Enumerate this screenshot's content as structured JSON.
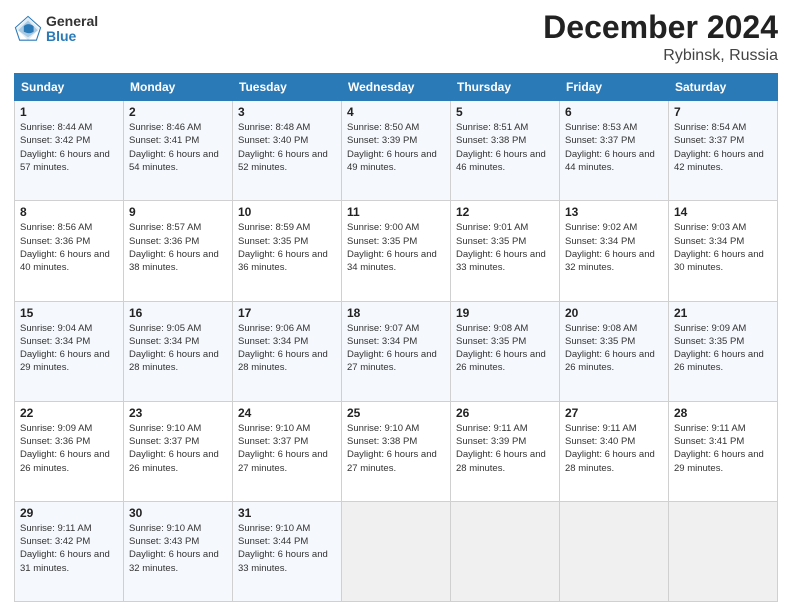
{
  "header": {
    "logo_general": "General",
    "logo_blue": "Blue",
    "title": "December 2024",
    "location": "Rybinsk, Russia"
  },
  "columns": [
    "Sunday",
    "Monday",
    "Tuesday",
    "Wednesday",
    "Thursday",
    "Friday",
    "Saturday"
  ],
  "weeks": [
    [
      {
        "day": "1",
        "sunrise": "Sunrise: 8:44 AM",
        "sunset": "Sunset: 3:42 PM",
        "daylight": "Daylight: 6 hours and 57 minutes."
      },
      {
        "day": "2",
        "sunrise": "Sunrise: 8:46 AM",
        "sunset": "Sunset: 3:41 PM",
        "daylight": "Daylight: 6 hours and 54 minutes."
      },
      {
        "day": "3",
        "sunrise": "Sunrise: 8:48 AM",
        "sunset": "Sunset: 3:40 PM",
        "daylight": "Daylight: 6 hours and 52 minutes."
      },
      {
        "day": "4",
        "sunrise": "Sunrise: 8:50 AM",
        "sunset": "Sunset: 3:39 PM",
        "daylight": "Daylight: 6 hours and 49 minutes."
      },
      {
        "day": "5",
        "sunrise": "Sunrise: 8:51 AM",
        "sunset": "Sunset: 3:38 PM",
        "daylight": "Daylight: 6 hours and 46 minutes."
      },
      {
        "day": "6",
        "sunrise": "Sunrise: 8:53 AM",
        "sunset": "Sunset: 3:37 PM",
        "daylight": "Daylight: 6 hours and 44 minutes."
      },
      {
        "day": "7",
        "sunrise": "Sunrise: 8:54 AM",
        "sunset": "Sunset: 3:37 PM",
        "daylight": "Daylight: 6 hours and 42 minutes."
      }
    ],
    [
      {
        "day": "8",
        "sunrise": "Sunrise: 8:56 AM",
        "sunset": "Sunset: 3:36 PM",
        "daylight": "Daylight: 6 hours and 40 minutes."
      },
      {
        "day": "9",
        "sunrise": "Sunrise: 8:57 AM",
        "sunset": "Sunset: 3:36 PM",
        "daylight": "Daylight: 6 hours and 38 minutes."
      },
      {
        "day": "10",
        "sunrise": "Sunrise: 8:59 AM",
        "sunset": "Sunset: 3:35 PM",
        "daylight": "Daylight: 6 hours and 36 minutes."
      },
      {
        "day": "11",
        "sunrise": "Sunrise: 9:00 AM",
        "sunset": "Sunset: 3:35 PM",
        "daylight": "Daylight: 6 hours and 34 minutes."
      },
      {
        "day": "12",
        "sunrise": "Sunrise: 9:01 AM",
        "sunset": "Sunset: 3:35 PM",
        "daylight": "Daylight: 6 hours and 33 minutes."
      },
      {
        "day": "13",
        "sunrise": "Sunrise: 9:02 AM",
        "sunset": "Sunset: 3:34 PM",
        "daylight": "Daylight: 6 hours and 32 minutes."
      },
      {
        "day": "14",
        "sunrise": "Sunrise: 9:03 AM",
        "sunset": "Sunset: 3:34 PM",
        "daylight": "Daylight: 6 hours and 30 minutes."
      }
    ],
    [
      {
        "day": "15",
        "sunrise": "Sunrise: 9:04 AM",
        "sunset": "Sunset: 3:34 PM",
        "daylight": "Daylight: 6 hours and 29 minutes."
      },
      {
        "day": "16",
        "sunrise": "Sunrise: 9:05 AM",
        "sunset": "Sunset: 3:34 PM",
        "daylight": "Daylight: 6 hours and 28 minutes."
      },
      {
        "day": "17",
        "sunrise": "Sunrise: 9:06 AM",
        "sunset": "Sunset: 3:34 PM",
        "daylight": "Daylight: 6 hours and 28 minutes."
      },
      {
        "day": "18",
        "sunrise": "Sunrise: 9:07 AM",
        "sunset": "Sunset: 3:34 PM",
        "daylight": "Daylight: 6 hours and 27 minutes."
      },
      {
        "day": "19",
        "sunrise": "Sunrise: 9:08 AM",
        "sunset": "Sunset: 3:35 PM",
        "daylight": "Daylight: 6 hours and 26 minutes."
      },
      {
        "day": "20",
        "sunrise": "Sunrise: 9:08 AM",
        "sunset": "Sunset: 3:35 PM",
        "daylight": "Daylight: 6 hours and 26 minutes."
      },
      {
        "day": "21",
        "sunrise": "Sunrise: 9:09 AM",
        "sunset": "Sunset: 3:35 PM",
        "daylight": "Daylight: 6 hours and 26 minutes."
      }
    ],
    [
      {
        "day": "22",
        "sunrise": "Sunrise: 9:09 AM",
        "sunset": "Sunset: 3:36 PM",
        "daylight": "Daylight: 6 hours and 26 minutes."
      },
      {
        "day": "23",
        "sunrise": "Sunrise: 9:10 AM",
        "sunset": "Sunset: 3:37 PM",
        "daylight": "Daylight: 6 hours and 26 minutes."
      },
      {
        "day": "24",
        "sunrise": "Sunrise: 9:10 AM",
        "sunset": "Sunset: 3:37 PM",
        "daylight": "Daylight: 6 hours and 27 minutes."
      },
      {
        "day": "25",
        "sunrise": "Sunrise: 9:10 AM",
        "sunset": "Sunset: 3:38 PM",
        "daylight": "Daylight: 6 hours and 27 minutes."
      },
      {
        "day": "26",
        "sunrise": "Sunrise: 9:11 AM",
        "sunset": "Sunset: 3:39 PM",
        "daylight": "Daylight: 6 hours and 28 minutes."
      },
      {
        "day": "27",
        "sunrise": "Sunrise: 9:11 AM",
        "sunset": "Sunset: 3:40 PM",
        "daylight": "Daylight: 6 hours and 28 minutes."
      },
      {
        "day": "28",
        "sunrise": "Sunrise: 9:11 AM",
        "sunset": "Sunset: 3:41 PM",
        "daylight": "Daylight: 6 hours and 29 minutes."
      }
    ],
    [
      {
        "day": "29",
        "sunrise": "Sunrise: 9:11 AM",
        "sunset": "Sunset: 3:42 PM",
        "daylight": "Daylight: 6 hours and 31 minutes."
      },
      {
        "day": "30",
        "sunrise": "Sunrise: 9:10 AM",
        "sunset": "Sunset: 3:43 PM",
        "daylight": "Daylight: 6 hours and 32 minutes."
      },
      {
        "day": "31",
        "sunrise": "Sunrise: 9:10 AM",
        "sunset": "Sunset: 3:44 PM",
        "daylight": "Daylight: 6 hours and 33 minutes."
      },
      null,
      null,
      null,
      null
    ]
  ]
}
